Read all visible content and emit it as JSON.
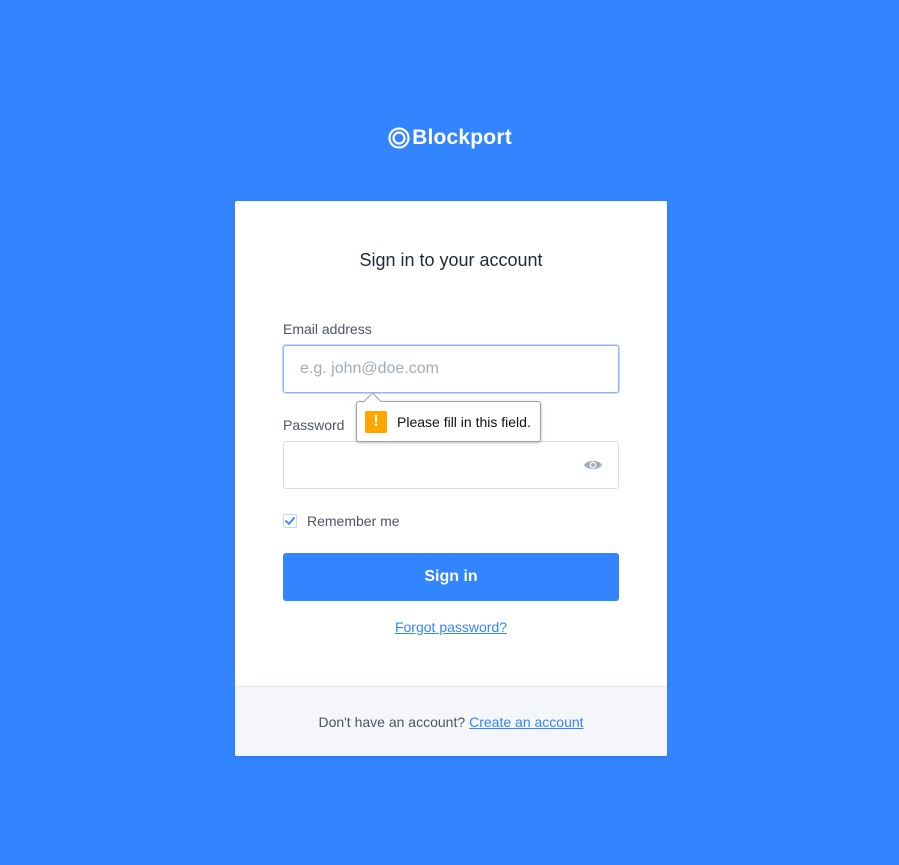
{
  "brand": {
    "name": "Blockport",
    "logo_icon": "blockport-logo-icon"
  },
  "card": {
    "title": "Sign in to your account",
    "email": {
      "label": "Email address",
      "placeholder": "e.g. john@doe.com",
      "value": ""
    },
    "password": {
      "label": "Password",
      "value": "",
      "toggle_icon": "eye-icon"
    },
    "remember": {
      "label": "Remember me",
      "checked": true
    },
    "signin_label": "Sign in",
    "forgot_label": "Forgot password?"
  },
  "footer": {
    "text": "Don't have an account?",
    "link_label": "Create an account"
  },
  "validation_tooltip": {
    "message": "Please fill in this field.",
    "icon": "warning-icon"
  },
  "colors": {
    "background": "#3385ff",
    "accent": "#3385ff",
    "warning": "#ffa500"
  }
}
